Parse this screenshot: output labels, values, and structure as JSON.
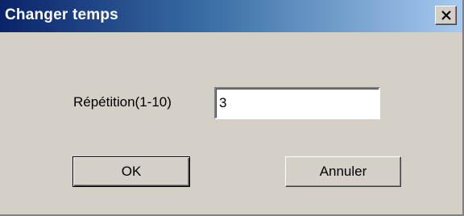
{
  "window": {
    "title": "Changer temps",
    "close_icon": "close-x-icon"
  },
  "form": {
    "repetition_label": "Répétition(1-10)",
    "repetition_value": "3"
  },
  "buttons": {
    "ok_label": "OK",
    "cancel_label": "Annuler"
  },
  "colors": {
    "titlebar_start": "#0a246a",
    "titlebar_end": "#a6caf0",
    "dialog_face": "#d4d0c8"
  }
}
